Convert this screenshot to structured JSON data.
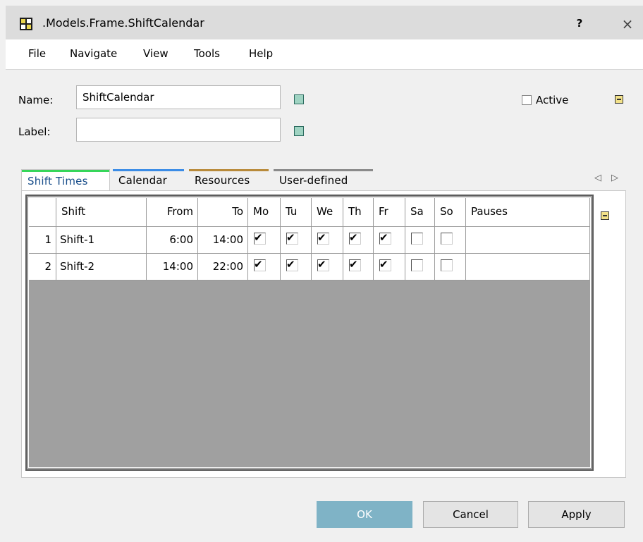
{
  "window": {
    "title": ".Models.Frame.ShiftCalendar",
    "help": "?",
    "close": "×"
  },
  "menu": [
    "File",
    "Navigate",
    "View",
    "Tools",
    "Help"
  ],
  "form": {
    "name_label": "Name:",
    "name_value": "ShiftCalendar",
    "label_label": "Label:",
    "label_value": "",
    "active_label": "Active",
    "active_checked": false
  },
  "tabs": [
    {
      "label": "Shift Times",
      "color": "#36d65a",
      "active": true
    },
    {
      "label": "Calendar",
      "color": "#3b8ce6",
      "active": false
    },
    {
      "label": "Resources",
      "color": "#b88a3a",
      "active": false
    },
    {
      "label": "User-defined",
      "color": "#8a8a8a",
      "active": false
    }
  ],
  "table": {
    "columns": [
      "Shift",
      "From",
      "To",
      "Mo",
      "Tu",
      "We",
      "Th",
      "Fr",
      "Sa",
      "So",
      "Pauses"
    ],
    "rows": [
      {
        "num": "1",
        "shift": "Shift-1",
        "from": "6:00",
        "to": "14:00",
        "days": [
          true,
          true,
          true,
          true,
          true,
          false,
          false
        ],
        "pauses": ""
      },
      {
        "num": "2",
        "shift": "Shift-2",
        "from": "14:00",
        "to": "22:00",
        "days": [
          true,
          true,
          true,
          true,
          true,
          false,
          false
        ],
        "pauses": ""
      }
    ]
  },
  "buttons": {
    "ok": "OK",
    "cancel": "Cancel",
    "apply": "Apply"
  }
}
